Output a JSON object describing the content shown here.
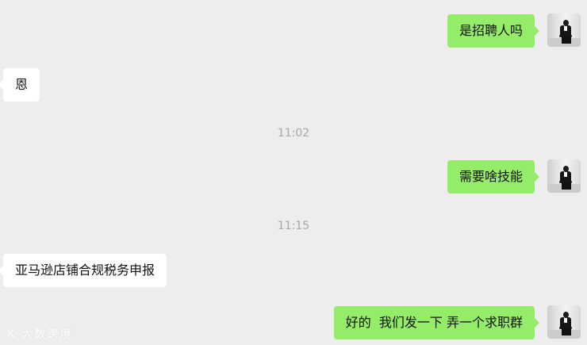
{
  "messages": [
    {
      "direction": "out",
      "text": "是招聘人吗"
    },
    {
      "direction": "in",
      "text": "恩"
    },
    {
      "type": "time",
      "text": "11:02"
    },
    {
      "direction": "out",
      "text": "需要啥技能"
    },
    {
      "type": "time",
      "text": "11:15"
    },
    {
      "direction": "in",
      "text": "亚马逊店铺合规税务申报"
    },
    {
      "direction": "out",
      "text": "好的  我们发一下 弄一个求职群"
    }
  ],
  "watermark": "K 大数跨境",
  "colors": {
    "background": "#ededed",
    "outgoing_bubble": "#95ec69",
    "incoming_bubble": "#ffffff",
    "timestamp_text": "#a8a8a8"
  },
  "icons": {
    "self_avatar": "avatar-photo-icon"
  }
}
